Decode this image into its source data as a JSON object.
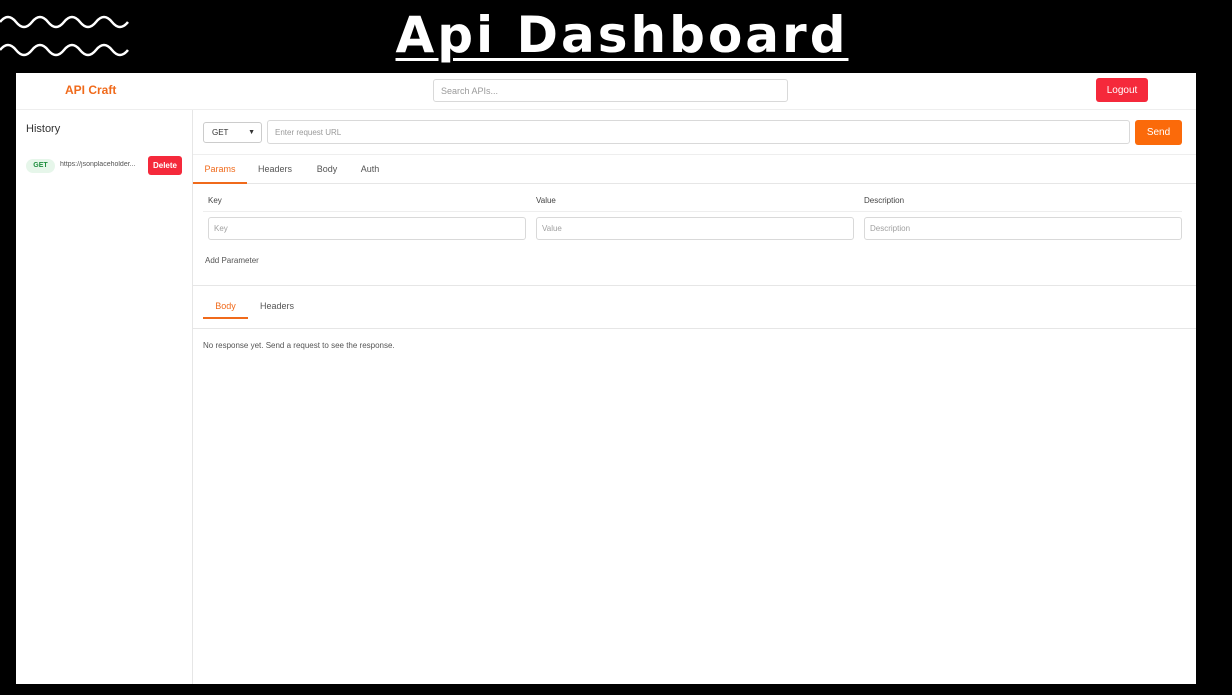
{
  "banner": {
    "title": "Api Dashboard"
  },
  "nav": {
    "brand": "API Craft",
    "search_placeholder": "Search APIs...",
    "logout_label": "Logout"
  },
  "sidebar": {
    "title": "History",
    "items": [
      {
        "method": "GET",
        "url": "https://jsonplaceholder...",
        "delete_label": "Delete"
      }
    ]
  },
  "request": {
    "method": "GET",
    "url_placeholder": "Enter request URL",
    "send_label": "Send"
  },
  "tabs": [
    {
      "label": "Params",
      "active": true
    },
    {
      "label": "Headers",
      "active": false
    },
    {
      "label": "Body",
      "active": false
    },
    {
      "label": "Auth",
      "active": false
    }
  ],
  "params": {
    "headers": [
      "Key",
      "Value",
      "Description"
    ],
    "placeholders": {
      "key": "Key",
      "value": "Value",
      "description": "Description"
    },
    "add_label": "Add Parameter"
  },
  "response": {
    "tabs": [
      {
        "label": "Body",
        "active": true
      },
      {
        "label": "Headers",
        "active": false
      }
    ],
    "empty_message": "No response yet. Send a request to see the response."
  },
  "colors": {
    "accent": "#f06a1b",
    "danger": "#f5293b",
    "send": "#fb6a0a",
    "get_badge": "#1e8e3e"
  }
}
